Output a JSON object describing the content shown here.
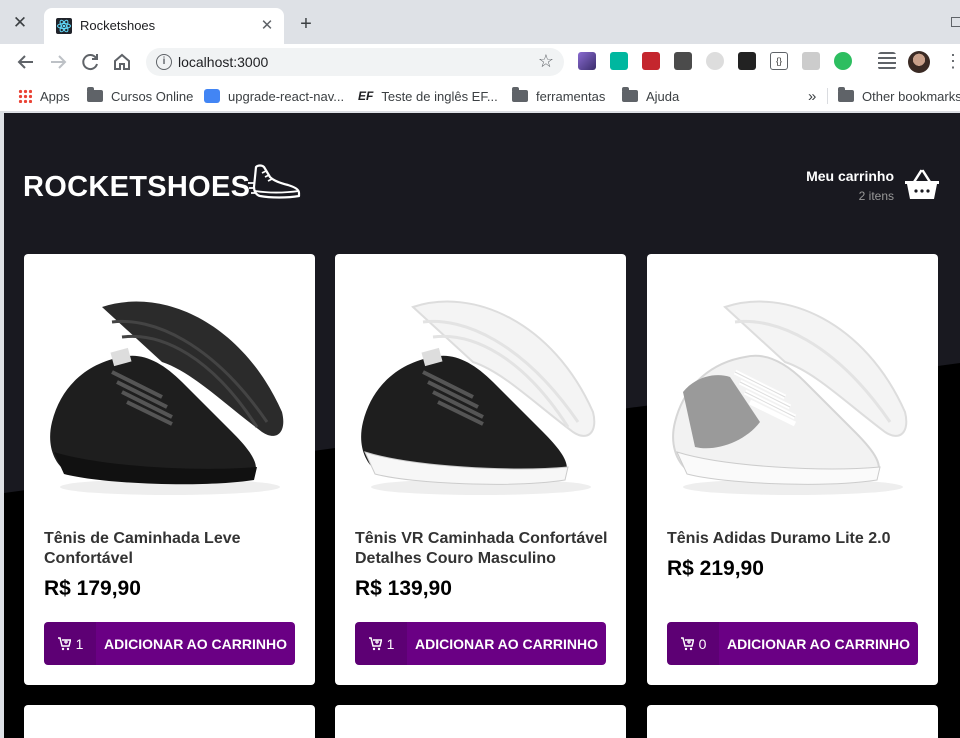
{
  "browser": {
    "tab_title": "Rocketshoes",
    "url": "localhost:3000",
    "bookmarks": [
      {
        "label": "Apps",
        "icon": "apps-grid-icon"
      },
      {
        "label": "Cursos Online",
        "icon": "folder-icon"
      },
      {
        "label": "upgrade-react-nav...",
        "icon": "google-cloud-icon"
      },
      {
        "label": "Teste de inglês EF...",
        "icon": "ef-icon"
      },
      {
        "label": "ferramentas",
        "icon": "folder-icon"
      },
      {
        "label": "Ajuda",
        "icon": "folder-icon"
      }
    ],
    "overflow_label": "»",
    "other_bookmarks": "Other bookmarks"
  },
  "header": {
    "logo": "ROCKETSHOES",
    "cart_title": "Meu carrinho",
    "cart_count": "2 itens"
  },
  "products": [
    {
      "title": "Tênis de Caminhada Leve Confortável",
      "price": "R$ 179,90",
      "qty": "1",
      "button": "ADICIONAR AO CARRINHO",
      "shoe": "black"
    },
    {
      "title": "Tênis VR Caminhada Confortável Detalhes Couro Masculino",
      "price": "R$ 139,90",
      "qty": "1",
      "button": "ADICIONAR AO CARRINHO",
      "shoe": "black-white"
    },
    {
      "title": "Tênis Adidas Duramo Lite 2.0",
      "price": "R$ 219,90",
      "qty": "0",
      "button": "ADICIONAR AO CARRINHO",
      "shoe": "white-grey"
    }
  ],
  "colors": {
    "accent": "#6a0084",
    "header_bg": "#191920",
    "page_bg": "#000000"
  }
}
